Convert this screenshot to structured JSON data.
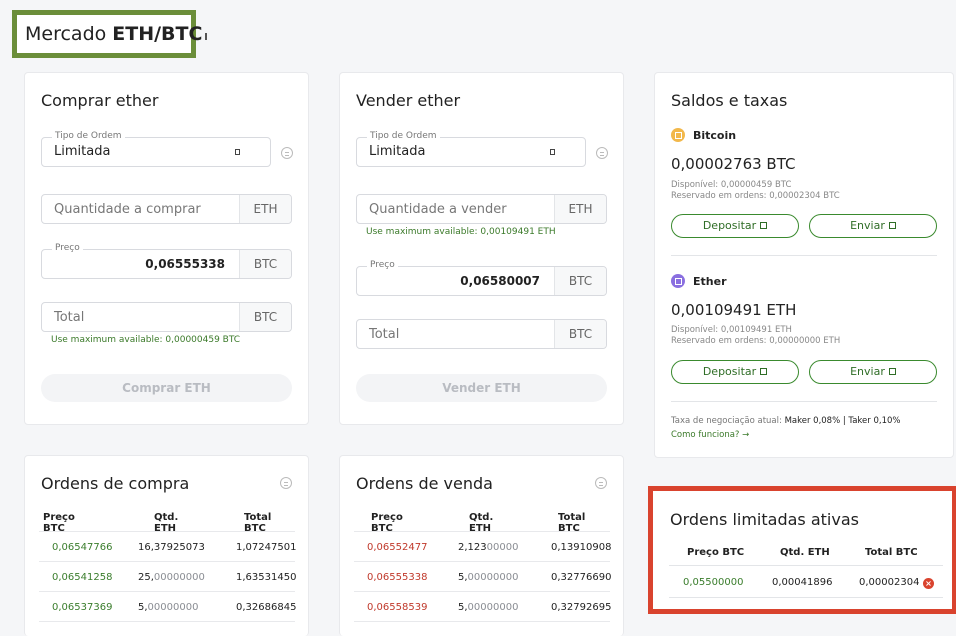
{
  "market": {
    "prefix": "Mercado",
    "pair": "ETH/BTC"
  },
  "buy": {
    "title": "Comprar ether",
    "order_type_legend": "Tipo de Ordem",
    "order_type_value": "Limitada",
    "quantity_placeholder": "Quantidade a comprar",
    "quantity_unit": "ETH",
    "price_legend": "Preço",
    "price_value": "0,06555338",
    "price_unit": "BTC",
    "total_placeholder": "Total",
    "total_unit": "BTC",
    "total_hint": "Use maximum available: 0,00000459 BTC",
    "submit_label": "Comprar ETH"
  },
  "sell": {
    "title": "Vender ether",
    "order_type_legend": "Tipo de Ordem",
    "order_type_value": "Limitada",
    "quantity_placeholder": "Quantidade a vender",
    "quantity_unit": "ETH",
    "quantity_hint": "Use maximum available: 0,00109491 ETH",
    "price_legend": "Preço",
    "price_value": "0,06580007",
    "price_unit": "BTC",
    "total_placeholder": "Total",
    "total_unit": "BTC",
    "submit_label": "Vender ETH"
  },
  "balances": {
    "title": "Saldos e taxas",
    "btc": {
      "name": "Bitcoin",
      "color": "#f2b84b",
      "amount": "0,00002763 BTC",
      "available": "Disponível: 0,00000459 BTC",
      "reserved": "Reservado em ordens: 0,00002304 BTC",
      "deposit": "Depositar",
      "send": "Enviar"
    },
    "eth": {
      "name": "Ether",
      "color": "#8a6fe0",
      "amount": "0,00109491 ETH",
      "available": "Disponível: 0,00109491 ETH",
      "reserved": "Reservado em ordens: 0,00000000 ETH",
      "deposit": "Depositar",
      "send": "Enviar"
    },
    "fee_label": "Taxa de negociação atual:",
    "fee_value": "Maker 0,08% | Taker 0,10%",
    "how_link": "Como funciona? →"
  },
  "buy_orders": {
    "title": "Ordens de compra",
    "headers": [
      "Preço BTC",
      "Qtd. ETH",
      "Total BTC"
    ],
    "rows": [
      {
        "price": "0,06547766",
        "qty_main": "16,37925073",
        "qty_tail": "",
        "total": "1,07247501"
      },
      {
        "price": "0,06541258",
        "qty_main": "25,",
        "qty_tail": "00000000",
        "total": "1,63531450"
      },
      {
        "price": "0,06537369",
        "qty_main": "5,",
        "qty_tail": "00000000",
        "total": "0,32686845"
      }
    ]
  },
  "sell_orders": {
    "title": "Ordens de venda",
    "headers": [
      "Preço BTC",
      "Qtd. ETH",
      "Total BTC"
    ],
    "rows": [
      {
        "price": "0,06552477",
        "qty_main": "2,123",
        "qty_tail": "00000",
        "total": "0,13910908"
      },
      {
        "price": "0,06555338",
        "qty_main": "5,",
        "qty_tail": "00000000",
        "total": "0,32776690"
      },
      {
        "price": "0,06558539",
        "qty_main": "5,",
        "qty_tail": "00000000",
        "total": "0,32792695"
      }
    ]
  },
  "active_orders": {
    "title": "Ordens limitadas ativas",
    "headers": [
      "Preço BTC",
      "Qtd. ETH",
      "Total BTC"
    ],
    "rows": [
      {
        "price": "0,05500000",
        "qty": "0,00041896",
        "total": "0,00002304"
      }
    ],
    "cancel_icon": "close-circle-icon"
  }
}
